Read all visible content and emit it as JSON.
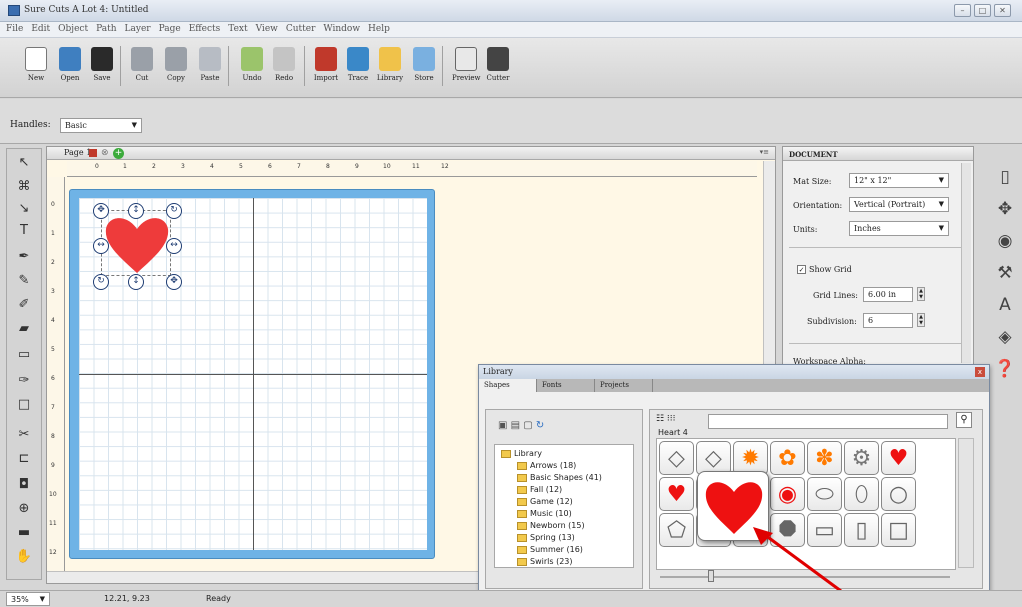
{
  "window": {
    "title": "Sure Cuts A Lot 4: Untitled"
  },
  "menu": [
    "File",
    "Edit",
    "Object",
    "Path",
    "Layer",
    "Page",
    "Effects",
    "Text",
    "View",
    "Cutter",
    "Window",
    "Help"
  ],
  "toolbar": {
    "new": "New",
    "open": "Open",
    "save": "Save",
    "cut": "Cut",
    "copy": "Copy",
    "paste": "Paste",
    "undo": "Undo",
    "redo": "Redo",
    "import": "Import",
    "trace": "Trace",
    "library": "Library",
    "store": "Store",
    "preview": "Preview",
    "cutter": "Cutter"
  },
  "handles": {
    "label": "Handles:",
    "value": "Basic"
  },
  "document_tab": {
    "page_label": "Page 1"
  },
  "ruler": {
    "h": [
      "0",
      "1",
      "2",
      "3",
      "4",
      "5",
      "6",
      "7",
      "8",
      "9",
      "10",
      "11",
      "12"
    ],
    "v": [
      "0",
      "1",
      "2",
      "3",
      "4",
      "5",
      "6",
      "7",
      "8",
      "9",
      "10",
      "11",
      "12"
    ]
  },
  "document_panel": {
    "title": "DOCUMENT",
    "mat_size_label": "Mat Size:",
    "mat_size": "12\" x 12\"",
    "orientation_label": "Orientation:",
    "orientation": "Vertical (Portrait)",
    "units_label": "Units:",
    "units": "Inches",
    "show_grid": "Show Grid",
    "grid_lines_label": "Grid Lines:",
    "grid_lines": "6.00 in",
    "subdivision_label": "Subdivision:",
    "subdivision": "6",
    "workspace_alpha": "Workspace Alpha:"
  },
  "library": {
    "title": "Library",
    "tabs": [
      "Shapes",
      "Fonts",
      "Projects"
    ],
    "shape_name": "Heart 4",
    "tree_root": "Library",
    "folders": [
      "Arrows (18)",
      "Basic Shapes (41)",
      "Fall (12)",
      "Game (12)",
      "Music (10)",
      "Newborn (15)",
      "Spring (13)",
      "Summer (16)",
      "Swirls (23)"
    ]
  },
  "status": {
    "zoom": "35%",
    "coords": "12.21, 9.23",
    "state": "Ready"
  },
  "colors": {
    "heart": "#ee3b3b",
    "mat": "#6fb3e6",
    "accent_arrow": "#e00000"
  }
}
